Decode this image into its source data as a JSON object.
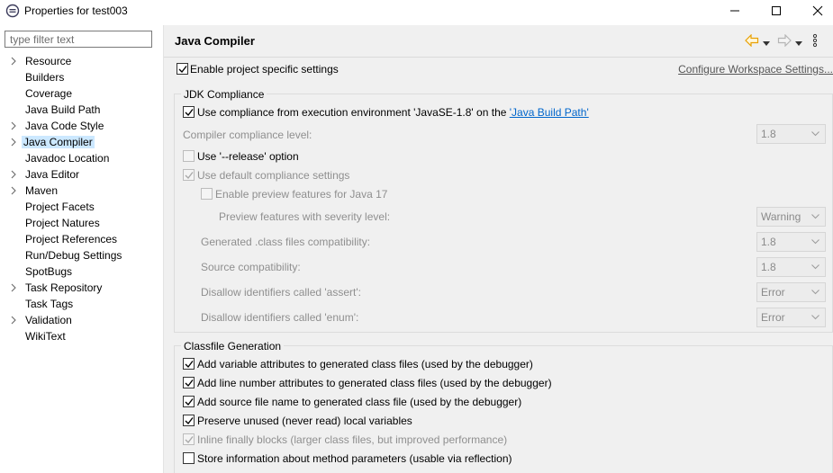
{
  "window": {
    "title": "Properties for test003",
    "controls": {
      "minimize": "minimize",
      "maximize": "maximize",
      "close": "close"
    }
  },
  "sidebar": {
    "filter_placeholder": "type filter text",
    "items": [
      {
        "label": "Resource",
        "expandable": true,
        "selected": false
      },
      {
        "label": "Builders",
        "expandable": false,
        "selected": false
      },
      {
        "label": "Coverage",
        "expandable": false,
        "selected": false
      },
      {
        "label": "Java Build Path",
        "expandable": false,
        "selected": false
      },
      {
        "label": "Java Code Style",
        "expandable": true,
        "selected": false
      },
      {
        "label": "Java Compiler",
        "expandable": true,
        "selected": true
      },
      {
        "label": "Javadoc Location",
        "expandable": false,
        "selected": false
      },
      {
        "label": "Java Editor",
        "expandable": true,
        "selected": false
      },
      {
        "label": "Maven",
        "expandable": true,
        "selected": false
      },
      {
        "label": "Project Facets",
        "expandable": false,
        "selected": false
      },
      {
        "label": "Project Natures",
        "expandable": false,
        "selected": false
      },
      {
        "label": "Project References",
        "expandable": false,
        "selected": false
      },
      {
        "label": "Run/Debug Settings",
        "expandable": false,
        "selected": false
      },
      {
        "label": "SpotBugs",
        "expandable": false,
        "selected": false
      },
      {
        "label": "Task Repository",
        "expandable": true,
        "selected": false
      },
      {
        "label": "Task Tags",
        "expandable": false,
        "selected": false
      },
      {
        "label": "Validation",
        "expandable": true,
        "selected": false
      },
      {
        "label": "WikiText",
        "expandable": false,
        "selected": false
      }
    ]
  },
  "main": {
    "title": "Java Compiler",
    "enable_project_specific": {
      "label": "Enable project specific settings",
      "checked": true
    },
    "configure_link": "Configure Workspace Settings...",
    "jdk": {
      "group_title": "JDK Compliance",
      "use_compliance_prefix": "Use compliance from execution environment 'JavaSE-1.8' on the ",
      "use_compliance_link": "'Java Build Path'",
      "use_compliance_checked": true,
      "compliance_level_label": "Compiler compliance level:",
      "compliance_level_value": "1.8",
      "use_release_label": "Use '--release' option",
      "use_default_label": "Use default compliance settings",
      "preview_label": "Enable preview features for Java 17",
      "preview_severity_label": "Preview features with severity level:",
      "preview_severity_value": "Warning",
      "generated_label": "Generated .class files compatibility:",
      "generated_value": "1.8",
      "source_label": "Source compatibility:",
      "source_value": "1.8",
      "assert_label": "Disallow identifiers called 'assert':",
      "assert_value": "Error",
      "enum_label": "Disallow identifiers called 'enum':",
      "enum_value": "Error"
    },
    "classfile": {
      "group_title": "Classfile Generation",
      "options": [
        {
          "label": "Add variable attributes to generated class files (used by the debugger)",
          "checked": true,
          "enabled": true
        },
        {
          "label": "Add line number attributes to generated class files (used by the debugger)",
          "checked": true,
          "enabled": true
        },
        {
          "label": "Add source file name to generated class file (used by the debugger)",
          "checked": true,
          "enabled": true
        },
        {
          "label": "Preserve unused (never read) local variables",
          "checked": true,
          "enabled": true
        },
        {
          "label": "Inline finally blocks (larger class files, but improved performance)",
          "checked": true,
          "enabled": false
        },
        {
          "label": "Store information about method parameters (usable via reflection)",
          "checked": false,
          "enabled": true
        }
      ]
    }
  },
  "colors": {
    "selection": "#cce8ff",
    "link": "#0066cc",
    "panel": "#f0f0f0",
    "back_arrow": "#e8a000"
  }
}
